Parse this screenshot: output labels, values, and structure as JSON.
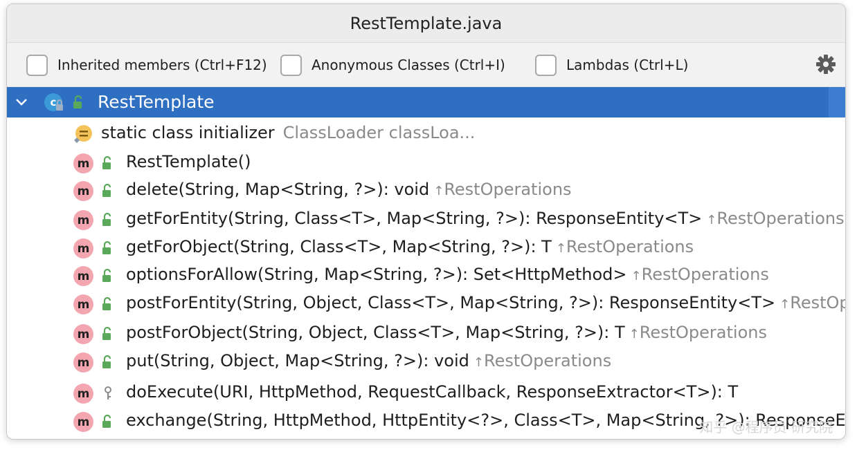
{
  "window": {
    "title": "RestTemplate.java"
  },
  "toolbar": {
    "inherited": {
      "label": "Inherited members (Ctrl+F12)",
      "checked": false
    },
    "anonymous": {
      "label": "Anonymous Classes (Ctrl+I)",
      "checked": false
    },
    "lambdas": {
      "label": "Lambdas (Ctrl+L)",
      "checked": false
    },
    "settings_icon": "gear-icon"
  },
  "tree": {
    "root": {
      "label": "RestTemplate",
      "icon": "class-icon",
      "expanded": true
    },
    "initializer": {
      "label": "static class initializer",
      "hint": "ClassLoader classLoa..."
    },
    "members": [
      {
        "sig": "RestTemplate()",
        "origin": "",
        "access": "public"
      },
      {
        "sig": "delete(String, Map<String, ?>): void",
        "origin": "RestOperations",
        "access": "public"
      },
      {
        "sig": "getForEntity(String, Class<T>, Map<String, ?>): ResponseEntity<T>",
        "origin": "RestOperations",
        "access": "public"
      },
      {
        "sig": "getForObject(String, Class<T>, Map<String, ?>): T",
        "origin": "RestOperations",
        "access": "public"
      },
      {
        "sig": "optionsForAllow(String, Map<String, ?>): Set<HttpMethod>",
        "origin": "RestOperations",
        "access": "public"
      },
      {
        "sig": "postForEntity(String, Object, Class<T>, Map<String, ?>): ResponseEntity<T>",
        "origin": "RestOpera",
        "access": "public"
      },
      {
        "sig": "postForObject(String, Object, Class<T>, Map<String, ?>): T",
        "origin": "RestOperations",
        "access": "public"
      },
      {
        "sig": "put(String, Object, Map<String, ?>): void",
        "origin": "RestOperations",
        "access": "public"
      },
      {
        "sig": "doExecute(URI, HttpMethod, RequestCallback, ResponseExtractor<T>): T",
        "origin": "",
        "access": "protected"
      },
      {
        "sig": "exchange(String, HttpMethod, HttpEntity<?>, Class<T>, Map<String, ?>): ResponseEntit",
        "origin": "",
        "access": "public"
      }
    ]
  },
  "colors": {
    "selection": "#2f6fc1",
    "method_badge": "#f3a6b0",
    "lock_green": "#5aa85a",
    "muted": "#8a8a8a"
  },
  "watermark": "知乎 @程序员 研究院"
}
